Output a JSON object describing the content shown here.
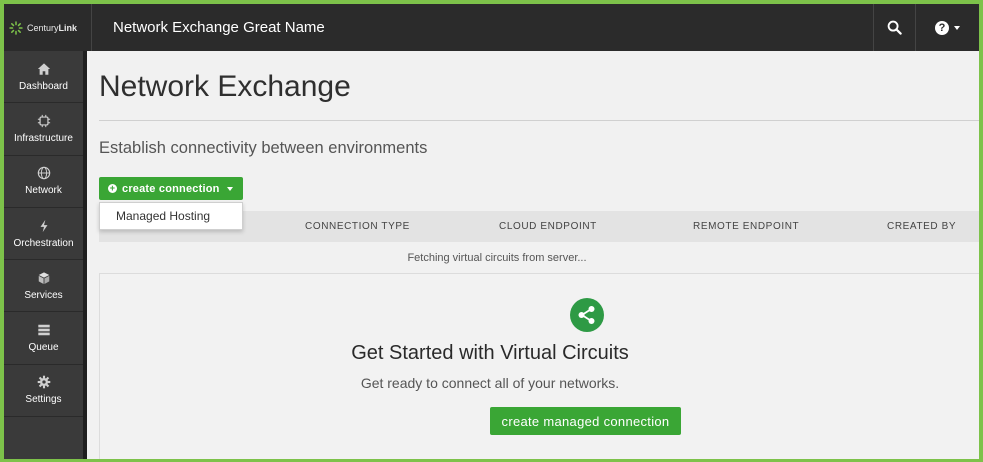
{
  "brand": {
    "name_light": "Century",
    "name_bold": "Link"
  },
  "header": {
    "app_title": "Network Exchange Great Name"
  },
  "sidebar": {
    "items": [
      {
        "label": "Dashboard",
        "icon": "home-icon"
      },
      {
        "label": "Infrastructure",
        "icon": "chip-icon"
      },
      {
        "label": "Network",
        "icon": "globe-icon"
      },
      {
        "label": "Orchestration",
        "icon": "orchestration-icon"
      },
      {
        "label": "Services",
        "icon": "cube-icon"
      },
      {
        "label": "Queue",
        "icon": "queue-icon"
      },
      {
        "label": "Settings",
        "icon": "gear-icon"
      }
    ]
  },
  "main": {
    "title": "Network Exchange",
    "subtitle": "Establish connectivity between environments",
    "create_button_label": "create connection",
    "dropdown": {
      "items": [
        "Managed Hosting"
      ]
    },
    "table": {
      "columns": [
        "CONNECTION TYPE",
        "CLOUD ENDPOINT",
        "REMOTE ENDPOINT",
        "CREATED BY"
      ],
      "status_text": "Fetching virtual circuits from server..."
    },
    "empty_state": {
      "title": "Get Started with Virtual Circuits",
      "subtitle": "Get ready to connect all of your networks.",
      "button_label": "create managed connection"
    }
  },
  "colors": {
    "accent_green": "#3aa635",
    "frame_green": "#7dc24a",
    "topbar": "#2b2b2b",
    "sidebar": "#3a3a3a"
  }
}
